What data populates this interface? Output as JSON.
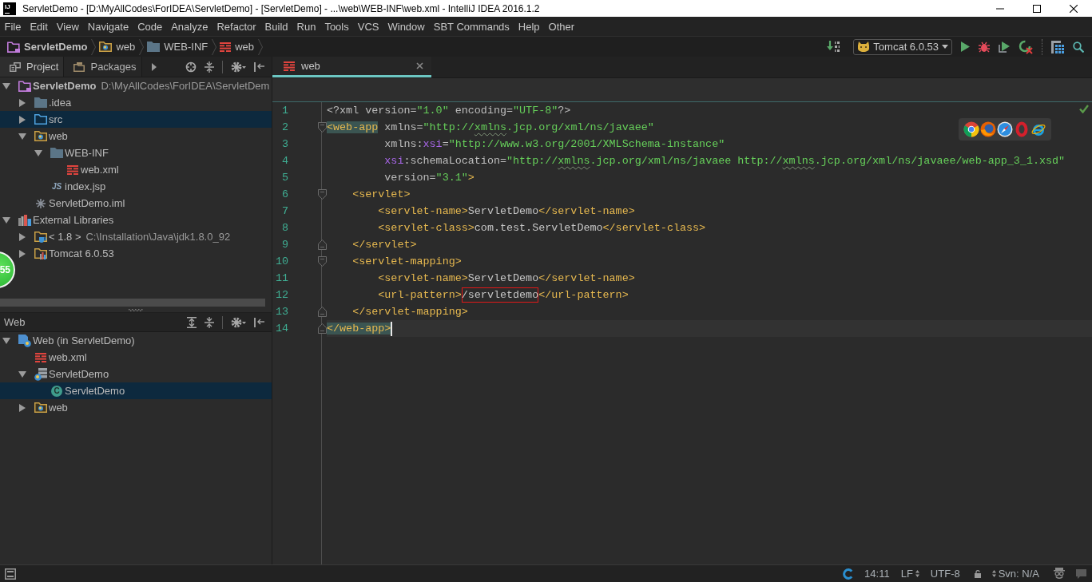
{
  "window": {
    "logo_text": "IJ",
    "title": "ServletDemo - [D:\\MyAllCodes\\ForIDEA\\ServletDemo] - [ServletDemo] - ...\\web\\WEB-INF\\web.xml - IntelliJ IDEA 2016.1.2"
  },
  "menu": [
    "File",
    "Edit",
    "View",
    "Navigate",
    "Code",
    "Analyze",
    "Refactor",
    "Build",
    "Run",
    "Tools",
    "VCS",
    "Window",
    "SBT Commands",
    "Help",
    "Other"
  ],
  "breadcrumbs": [
    {
      "kind": "module",
      "label": "ServletDemo"
    },
    {
      "kind": "web-folder",
      "label": "web"
    },
    {
      "kind": "folder",
      "label": "WEB-INF"
    },
    {
      "kind": "xml",
      "label": "web"
    }
  ],
  "run_config": {
    "label": "Tomcat 6.0.53"
  },
  "project_panel": {
    "tabs": [
      {
        "kind": "project",
        "label": "Project",
        "selected": true
      },
      {
        "kind": "packages",
        "label": "Packages",
        "selected": false
      }
    ],
    "tree": [
      {
        "kind": "module",
        "label": "ServletDemo",
        "detail": "D:\\MyAllCodes\\ForIDEA\\ServletDem",
        "expanded": true,
        "selected": false,
        "children": [
          {
            "kind": "folder",
            "label": ".idea",
            "expanded": false,
            "selected": false
          },
          {
            "kind": "source-folder",
            "label": "src",
            "expanded": false,
            "selected": true
          },
          {
            "kind": "web-folder",
            "label": "web",
            "expanded": true,
            "selected": false,
            "children": [
              {
                "kind": "folder",
                "label": "WEB-INF",
                "expanded": true,
                "selected": false,
                "children": [
                  {
                    "kind": "xml",
                    "label": "web.xml",
                    "selected": false
                  }
                ]
              },
              {
                "kind": "js",
                "icon_text": "JS",
                "label": "index.jsp",
                "selected": false
              }
            ]
          },
          {
            "kind": "iml",
            "label": "ServletDemo.iml",
            "selected": false
          }
        ]
      },
      {
        "kind": "libraries",
        "label": "External Libraries",
        "expanded": true,
        "selected": false,
        "children": [
          {
            "kind": "jdk",
            "label": "< 1.8 >",
            "detail": "C:\\Installation\\Java\\jdk1.8.0_92",
            "expanded": false,
            "selected": false
          },
          {
            "kind": "library",
            "label": "Tomcat 6.0.53",
            "expanded": false,
            "selected": false
          }
        ]
      }
    ]
  },
  "floating_badge": {
    "text": "55"
  },
  "web_panel": {
    "title": "Web",
    "tree": [
      {
        "kind": "web-facet",
        "label": "Web (in ServletDemo)",
        "expanded": true,
        "selected": false,
        "children": [
          {
            "kind": "xml",
            "label": "web.xml",
            "selected": false
          },
          {
            "kind": "servlet",
            "label": "ServletDemo",
            "expanded": true,
            "selected": false,
            "children": [
              {
                "kind": "class",
                "icon_text": "C",
                "label": "ServletDemo",
                "selected": true
              }
            ]
          },
          {
            "kind": "web-folder",
            "label": "web",
            "expanded": false,
            "selected": false
          }
        ]
      }
    ]
  },
  "editor": {
    "tabs": [
      {
        "kind": "xml",
        "label": "web",
        "selected": true
      }
    ],
    "lines": [
      {
        "number": "1",
        "current": false,
        "tokens": [
          {
            "kind": "attr",
            "text": "<?xml version="
          },
          {
            "kind": "value",
            "text": "\"1.0\""
          },
          {
            "kind": "attr",
            "text": " encoding="
          },
          {
            "kind": "value",
            "text": "\"UTF-8\""
          },
          {
            "kind": "attr",
            "text": "?>"
          }
        ]
      },
      {
        "number": "2",
        "current": false,
        "fold_start": true,
        "tokens": [
          {
            "kind": "tag",
            "text": "<web-app",
            "matched": true
          },
          {
            "kind": "attr",
            "text": " xmlns="
          },
          {
            "kind": "value",
            "text": "\"http://"
          },
          {
            "kind": "value",
            "text": "xmlns",
            "misspelled": true
          },
          {
            "kind": "value",
            "text": ".jcp.org/xml/ns/javaee\""
          }
        ]
      },
      {
        "number": "3",
        "current": false,
        "tokens": [
          {
            "kind": "attr",
            "text": "         xmlns:"
          },
          {
            "kind": "ns",
            "text": "xsi"
          },
          {
            "kind": "attr",
            "text": "="
          },
          {
            "kind": "value",
            "text": "\"http://www.w3.org/2001/XMLSchema-instance\""
          }
        ]
      },
      {
        "number": "4",
        "current": false,
        "tokens": [
          {
            "kind": "ns",
            "text": "         xsi"
          },
          {
            "kind": "attr",
            "text": ":schemaLocation="
          },
          {
            "kind": "value",
            "text": "\"http://"
          },
          {
            "kind": "value",
            "text": "xmlns",
            "misspelled": true
          },
          {
            "kind": "value",
            "text": ".jcp.org/xml/ns/javaee http://"
          },
          {
            "kind": "value",
            "text": "xmlns",
            "misspelled": true
          },
          {
            "kind": "value",
            "text": ".jcp.org/xml/ns/javaee/web-app_3_1.xsd\""
          }
        ]
      },
      {
        "number": "5",
        "current": false,
        "tokens": [
          {
            "kind": "attr",
            "text": "         version="
          },
          {
            "kind": "value",
            "text": "\"3.1\""
          },
          {
            "kind": "tag",
            "text": ">"
          }
        ]
      },
      {
        "number": "6",
        "current": false,
        "fold_start": true,
        "tokens": [
          {
            "kind": "tag",
            "text": "    <servlet>"
          }
        ]
      },
      {
        "number": "7",
        "current": false,
        "tokens": [
          {
            "kind": "tag",
            "text": "        <servlet-name>"
          },
          {
            "kind": "text",
            "text": "ServletDemo"
          },
          {
            "kind": "tag",
            "text": "</servlet-name>"
          }
        ]
      },
      {
        "number": "8",
        "current": false,
        "tokens": [
          {
            "kind": "tag",
            "text": "        <servlet-class>"
          },
          {
            "kind": "text",
            "text": "com.test.ServletDemo"
          },
          {
            "kind": "tag",
            "text": "</servlet-class>"
          }
        ]
      },
      {
        "number": "9",
        "current": false,
        "fold_end": true,
        "tokens": [
          {
            "kind": "tag",
            "text": "    </servlet>"
          }
        ]
      },
      {
        "number": "10",
        "current": false,
        "fold_start": true,
        "tokens": [
          {
            "kind": "tag",
            "text": "    <servlet-mapping>"
          }
        ]
      },
      {
        "number": "11",
        "current": false,
        "tokens": [
          {
            "kind": "tag",
            "text": "        <servlet-name>"
          },
          {
            "kind": "text",
            "text": "ServletDemo"
          },
          {
            "kind": "tag",
            "text": "</servlet-name>"
          }
        ]
      },
      {
        "number": "12",
        "current": false,
        "tokens": [
          {
            "kind": "tag",
            "text": "        <url-pattern>"
          },
          {
            "kind": "text",
            "text": "/servletdemo",
            "boxed": true
          },
          {
            "kind": "tag",
            "text": "</url-pattern>"
          }
        ]
      },
      {
        "number": "13",
        "current": false,
        "fold_end": true,
        "tokens": [
          {
            "kind": "tag",
            "text": "    </servlet-mapping>"
          }
        ]
      },
      {
        "number": "14",
        "current": true,
        "fold_end": true,
        "tokens": [
          {
            "kind": "tag",
            "text": "</web-app>",
            "matched": true
          }
        ]
      }
    ]
  },
  "status_bar": {
    "position": "14:11",
    "line_separator": "LF",
    "encoding": "UTF-8",
    "vcs": "Svn: N/A"
  }
}
